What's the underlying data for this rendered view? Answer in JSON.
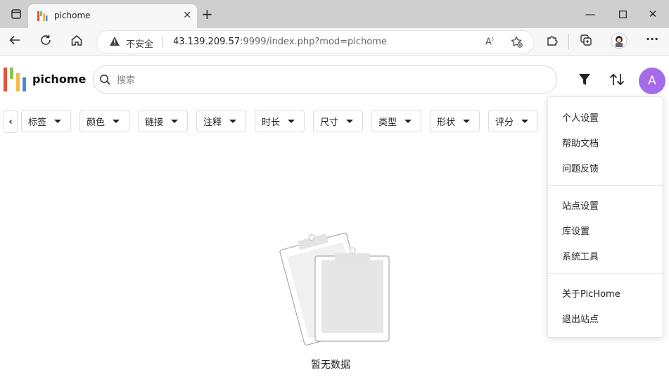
{
  "browser": {
    "tab_title": "pichome",
    "insecure_label": "不安全",
    "url_host": "43.139.209.57",
    "url_rest": ":9999/index.php?mod=pichome"
  },
  "app": {
    "brand": "pichome",
    "search_placeholder": "搜索",
    "avatar_letter": "A",
    "brand_colors": {
      "logo_red": "#e8503a",
      "logo_green": "#8cc152",
      "logo_yellow": "#f6bb42",
      "logo_blue": "#4a89dc",
      "avatar": "#a66be9"
    }
  },
  "filters": [
    "标签",
    "颜色",
    "链接",
    "注释",
    "时长",
    "尺寸",
    "类型",
    "形状",
    "评分"
  ],
  "empty_state": {
    "text": "暂无数据"
  },
  "user_menu": {
    "group1": [
      "个人设置",
      "帮助文档",
      "问题反馈"
    ],
    "group2": [
      "站点设置",
      "库设置",
      "系统工具"
    ],
    "group3": [
      "关于PicHome",
      "退出站点"
    ]
  }
}
